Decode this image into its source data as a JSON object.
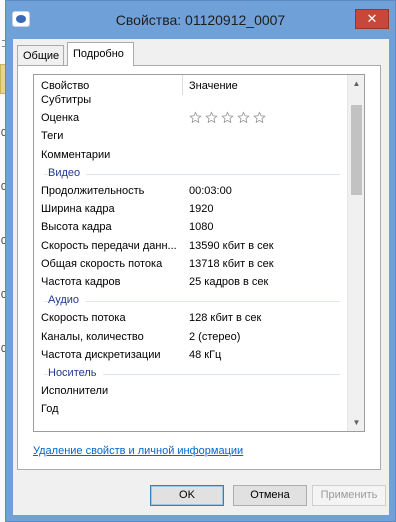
{
  "window": {
    "title": "Свойства: 01120912_0007",
    "close_label": "✕"
  },
  "background": {
    "numbers": [
      "0",
      "0",
      "0",
      "0",
      "0"
    ]
  },
  "tabs": [
    {
      "label": "Общие",
      "selected": false
    },
    {
      "label": "Подробно",
      "selected": true
    }
  ],
  "list": {
    "columns": {
      "property": "Свойство",
      "value": "Значение"
    },
    "rows": [
      {
        "kind": "prop",
        "name": "Субтитры",
        "value": ""
      },
      {
        "kind": "rating",
        "name": "Оценка",
        "stars": 0,
        "max_stars": 5
      },
      {
        "kind": "prop",
        "name": "Теги",
        "value": ""
      },
      {
        "kind": "prop",
        "name": "Комментарии",
        "value": ""
      },
      {
        "kind": "group",
        "name": "Видео"
      },
      {
        "kind": "prop",
        "name": "Продолжительность",
        "value": "00:03:00"
      },
      {
        "kind": "prop",
        "name": "Ширина кадра",
        "value": "1920"
      },
      {
        "kind": "prop",
        "name": "Высота кадра",
        "value": "1080"
      },
      {
        "kind": "prop",
        "name": "Скорость передачи данн...",
        "value": "13590 кбит в сек"
      },
      {
        "kind": "prop",
        "name": "Общая скорость потока",
        "value": "13718 кбит в сек"
      },
      {
        "kind": "prop",
        "name": "Частота кадров",
        "value": "25 кадров в сек"
      },
      {
        "kind": "group",
        "name": "Аудио"
      },
      {
        "kind": "prop",
        "name": "Скорость потока",
        "value": "128 кбит в сек"
      },
      {
        "kind": "prop",
        "name": "Каналы, количество",
        "value": "2 (стерео)"
      },
      {
        "kind": "prop",
        "name": "Частота дискретизации",
        "value": "48 кГц"
      },
      {
        "kind": "group",
        "name": "Носитель"
      },
      {
        "kind": "prop",
        "name": "Исполнители",
        "value": ""
      },
      {
        "kind": "prop",
        "name": "Год",
        "value": ""
      }
    ]
  },
  "remove_link": "Удаление свойств и личной информации",
  "buttons": {
    "ok": "OK",
    "cancel": "Отмена",
    "apply": "Применить"
  },
  "colors": {
    "window_frame": "#6fa0d8",
    "group_text": "#1e3a8c",
    "link": "#0066cc",
    "close_button": "#c7473a"
  }
}
